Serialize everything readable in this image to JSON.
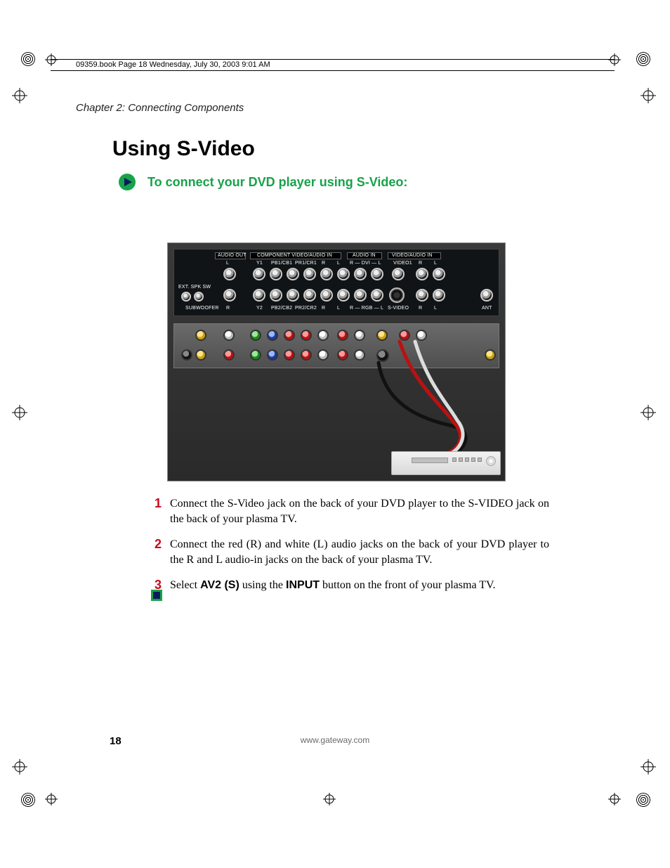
{
  "meta": {
    "book_line": "09359.book  Page 18  Wednesday, July 30, 2003  9:01 AM"
  },
  "chapter": "Chapter 2: Connecting Components",
  "heading": "Using S-Video",
  "subheading": "To connect your DVD player using S-Video:",
  "panel": {
    "audio_out": "AUDIO OUT",
    "component": "COMPONENT VIDEO/AUDIO IN",
    "audio_in": "AUDIO IN",
    "video_audio_in": "VIDEO/AUDIO IN",
    "rowL": "L",
    "rowR": "R",
    "y1": "Y1",
    "y2": "Y2",
    "pb1": "PB1/CB1",
    "pr1": "PR1/CR1",
    "pb2": "PB2/CB2",
    "pr2": "PR2/CR2",
    "dvi": "R — DVI — L",
    "rgb": "R — RGB — L",
    "svideo": "S-VIDEO",
    "video1": "VIDEO1",
    "ext": "EXT. SPK SW",
    "sub": "SUBWOOFER",
    "ant": "ANT"
  },
  "steps": [
    {
      "num": "1",
      "text": "Connect the S-Video jack on the back of your DVD player to the S-VIDEO jack on the back of your plasma TV."
    },
    {
      "num": "2",
      "text": "Connect the red (R) and white (L) audio jacks on the back of your DVD player to the R and L audio-in jacks on the back of your plasma TV."
    },
    {
      "num": "3",
      "text_pre": "Select ",
      "bold1": "AV2 (S)",
      "text_mid": " using the ",
      "bold2": "INPUT",
      "text_post": " button on the front of your plasma TV."
    }
  ],
  "footer": {
    "page": "18",
    "url": "www.gateway.com"
  }
}
